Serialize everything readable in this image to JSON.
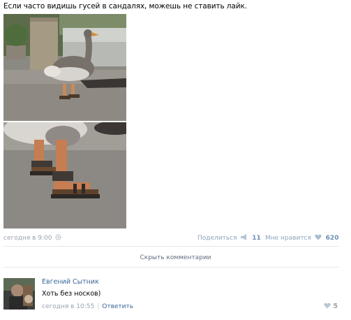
{
  "post": {
    "text": "Если часто видишь гусей в сандалях, можешь не ставить лайк.",
    "date": "сегодня в 9:00",
    "share_label": "Поделиться",
    "share_count": "11",
    "like_label": "Мне нравится",
    "like_count": "620"
  },
  "comments": {
    "toggle_label": "Скрыть комментарии",
    "items": [
      {
        "author": "Евгений Сытник",
        "text": "Хоть без носков)",
        "date": "сегодня в 10:55",
        "reply_label": "Ответить",
        "likes": "5"
      }
    ]
  },
  "icons": {
    "settings": "gear-icon",
    "share": "megaphone-icon",
    "like": "heart-icon"
  },
  "colors": {
    "link": "#3b6798",
    "meta": "#9aa3ad",
    "count": "#6c8fb4"
  }
}
